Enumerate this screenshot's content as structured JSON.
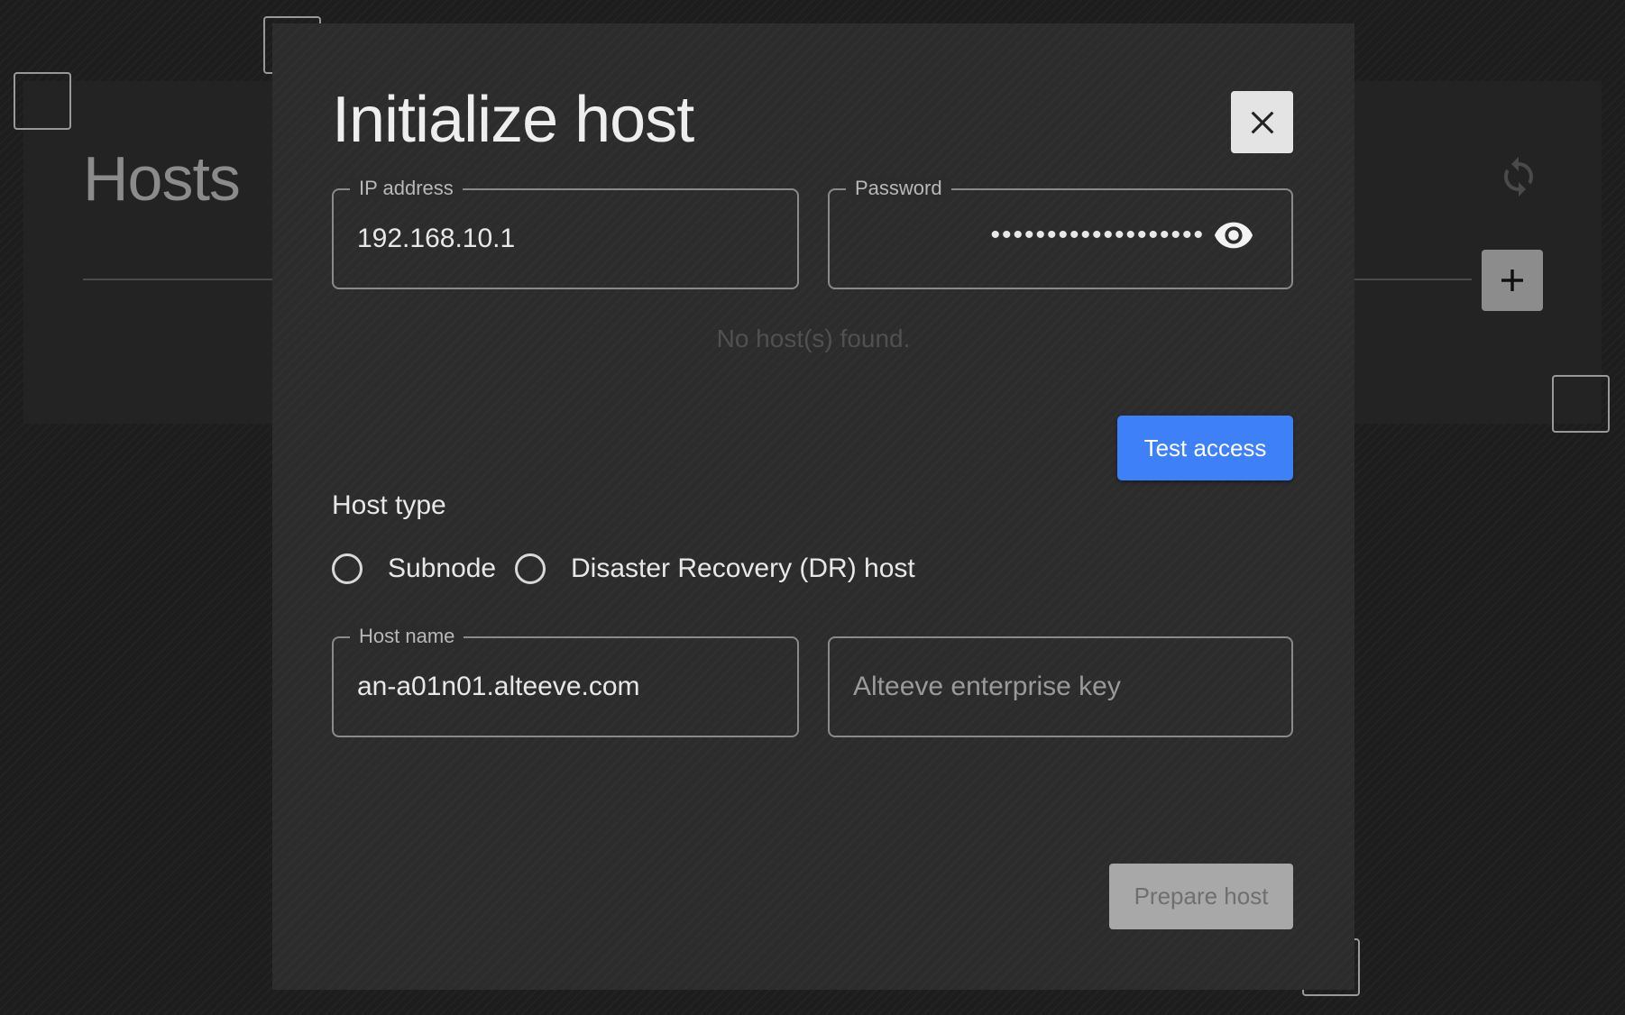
{
  "background": {
    "page_title": "Hosts",
    "refresh_icon": "refresh-icon",
    "add_icon": "plus-icon"
  },
  "dialog": {
    "title": "Initialize host",
    "close_icon": "close-icon",
    "ip_address": {
      "label": "IP address",
      "value": "192.168.10.1"
    },
    "password": {
      "label": "Password",
      "masked_value": "•••••••••••••••••••",
      "toggle_icon": "eye-icon"
    },
    "empty_message": "No host(s) found.",
    "test_access_label": "Test access",
    "host_type": {
      "label": "Host type",
      "options": [
        {
          "label": "Subnode",
          "selected": false
        },
        {
          "label": "Disaster Recovery (DR) host",
          "selected": false
        }
      ]
    },
    "host_name": {
      "label": "Host name",
      "value": "an-a01n01.alteeve.com"
    },
    "enterprise_key": {
      "placeholder": "Alteeve enterprise key",
      "value": ""
    },
    "prepare_host_label": "Prepare host"
  },
  "colors": {
    "accent": "#3e80f7",
    "dialog_bg": "#2c2c2c",
    "page_bg": "#1d1d1d",
    "disabled_button": "#a8a8a8"
  }
}
